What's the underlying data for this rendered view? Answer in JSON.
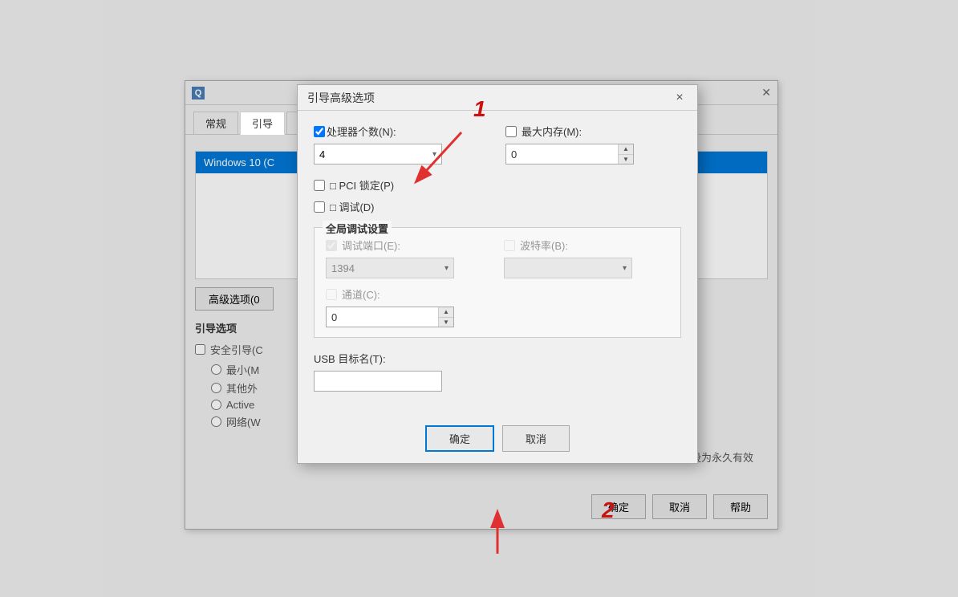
{
  "background": {
    "color": "#f0f0f0"
  },
  "bg_window": {
    "icon": "Q",
    "close_btn": "✕",
    "tabs": [
      {
        "label": "常规",
        "active": false
      },
      {
        "label": "引导",
        "active": true
      }
    ],
    "list_items": [
      {
        "label": "Windows 10 (C",
        "selected": true
      }
    ],
    "advanced_btn": "高级选项(0",
    "boot_options_title": "引导选项",
    "safe_boot_label": "安全引导(C",
    "radio_options": [
      {
        "label": "最小(M"
      },
      {
        "label": "其他外"
      },
      {
        "label": "Active"
      },
      {
        "label": "网络(W"
      }
    ],
    "permanent_text": "置设为永久有效",
    "footer_btns": [
      "确定",
      "取消",
      "帮助"
    ]
  },
  "modal": {
    "title": "引导高级选项",
    "close_btn": "×",
    "processor_count_label": "☑ 处理器个数(N):",
    "processor_count_checked": true,
    "processor_count_value": "4",
    "max_memory_label": "□ 最大内存(M):",
    "max_memory_checked": false,
    "max_memory_value": "0",
    "pci_lock_label": "□ PCI 锁定(P)",
    "pci_lock_checked": false,
    "debug_label": "□ 调试(D)",
    "debug_checked": false,
    "global_debug_title": "全局调试设置",
    "debug_port_label": "调试端口(E):",
    "debug_port_checked": true,
    "debug_port_value": "1394",
    "baud_rate_label": "波特率(B):",
    "baud_rate_checked": false,
    "channel_label": "通道(C):",
    "channel_checked": false,
    "channel_value": "0",
    "usb_target_label": "USB 目标名(T):",
    "usb_target_value": "",
    "ok_btn": "确定",
    "cancel_btn": "取消"
  },
  "annotations": {
    "number1": "1",
    "number2": "2"
  }
}
